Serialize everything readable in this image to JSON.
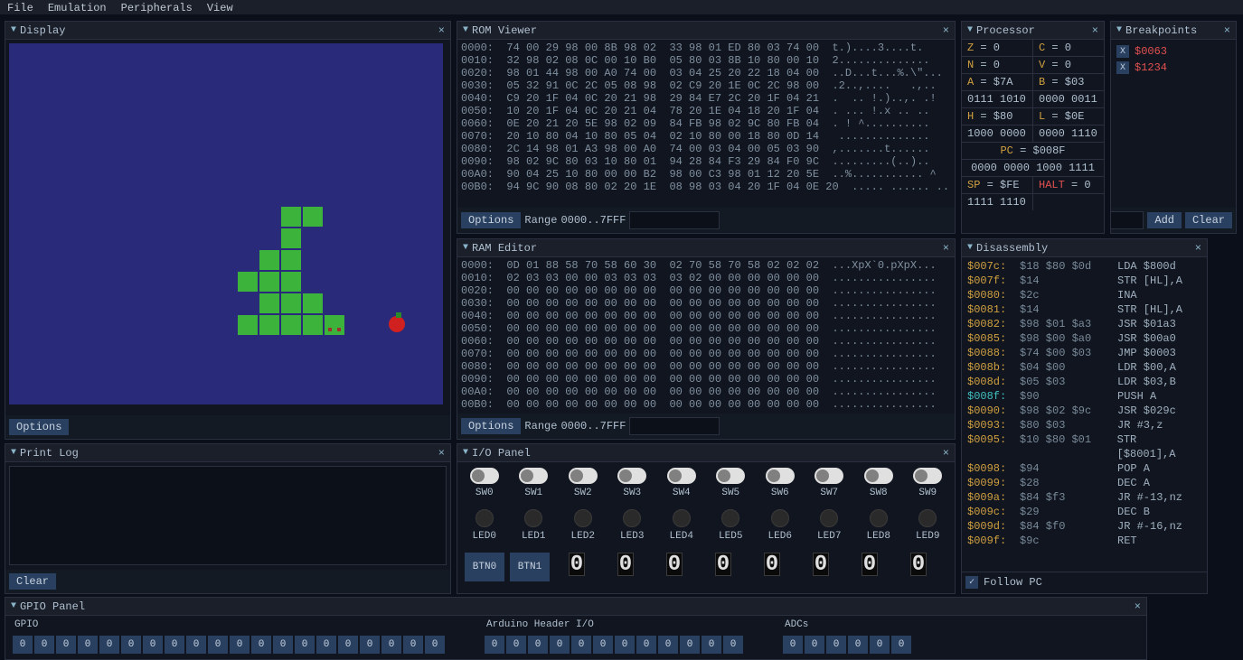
{
  "menu": {
    "file": "File",
    "emulation": "Emulation",
    "peripherals": "Peripherals",
    "view": "View"
  },
  "panels": {
    "display": {
      "title": "Display",
      "options": "Options"
    },
    "rom": {
      "title": "ROM Viewer",
      "options": "Options",
      "range_label": "Range",
      "range": "0000..7FFF"
    },
    "ram": {
      "title": "RAM Editor",
      "options": "Options",
      "range_label": "Range",
      "range": "0000..7FFF"
    },
    "processor": {
      "title": "Processor"
    },
    "breakpoints": {
      "title": "Breakpoints",
      "add": "Add",
      "clear": "Clear"
    },
    "disassembly": {
      "title": "Disassembly",
      "follow": "Follow PC"
    },
    "printlog": {
      "title": "Print Log",
      "clear": "Clear"
    },
    "io": {
      "title": "I/O Panel"
    },
    "gpio": {
      "title": "GPIO Panel",
      "gpio_label": "GPIO",
      "arduino_label": "Arduino Header I/O",
      "adc_label": "ADCs"
    }
  },
  "rom_lines": [
    "0000:  74 00 29 98 00 8B 98 02  33 98 01 ED 80 03 74 00  t.)....3....t.",
    "0010:  32 98 02 08 0C 00 10 B0  05 80 03 8B 10 80 00 10  2..............",
    "0020:  98 01 44 98 00 A0 74 00  03 04 25 20 22 18 04 00  ..D...t...%.\\\"...",
    "0030:  05 32 91 0C 2C 05 08 98  02 C9 20 1E 0C 2C 98 00  .2..,....   .,..",
    "0040:  C9 20 1F 04 0C 20 21 98  29 84 E7 2C 20 1F 04 21  .  .. !.)..,. .!",
    "0050:  10 20 1F 04 0C 20 21 04  78 20 1E 04 18 20 1F 04  . ... !.x .. ..",
    "0060:  0E 20 21 20 5E 98 02 09  84 FB 98 02 9C 80 FB 04  . ! ^..........",
    "0070:  20 10 80 04 10 80 05 04  02 10 80 00 18 80 0D 14   ..............",
    "0080:  2C 14 98 01 A3 98 00 A0  74 00 03 04 00 05 03 90  ,.......t......",
    "0090:  98 02 9C 80 03 10 80 01  94 28 84 F3 29 84 F0 9C  .........(..)..",
    "00A0:  90 04 25 10 80 00 00 B2  98 00 C3 98 01 12 20 5E  ..%........... ^",
    "00B0:  94 9C 90 08 80 02 20 1E  08 98 03 04 20 1F 04 0E 20  ..... ...... .. "
  ],
  "ram_lines": [
    "0000:  0D 01 88 58 70 58 60 30  02 70 58 70 58 02 02 02  ...XpX`0.pXpX...",
    "0010:  02 03 03 00 00 03 03 03  03 02 00 00 00 00 00 00  ................",
    "0020:  00 00 00 00 00 00 00 00  00 00 00 00 00 00 00 00  ................",
    "0030:  00 00 00 00 00 00 00 00  00 00 00 00 00 00 00 00  ................",
    "0040:  00 00 00 00 00 00 00 00  00 00 00 00 00 00 00 00  ................",
    "0050:  00 00 00 00 00 00 00 00  00 00 00 00 00 00 00 00  ................",
    "0060:  00 00 00 00 00 00 00 00  00 00 00 00 00 00 00 00  ................",
    "0070:  00 00 00 00 00 00 00 00  00 00 00 00 00 00 00 00  ................",
    "0080:  00 00 00 00 00 00 00 00  00 00 00 00 00 00 00 00  ................",
    "0090:  00 00 00 00 00 00 00 00  00 00 00 00 00 00 00 00  ................",
    "00A0:  00 00 00 00 00 00 00 00  00 00 00 00 00 00 00 00  ................",
    "00B0:  00 00 00 00 00 00 00 00  00 00 00 00 00 00 00 00  ................"
  ],
  "processor": {
    "Z": "Z = 0",
    "C": "C = 0",
    "N": "N = 0",
    "V": "V = 0",
    "A": "A = $7A",
    "B": "B = $03",
    "A_bits": "0111 1010",
    "B_bits": "0000 0011",
    "H": "H = $80",
    "L": "L = $0E",
    "H_bits": "1000 0000",
    "L_bits": "0000 1110",
    "PC": "PC = $008F",
    "PC_bits": "0000 0000 1000 1111",
    "SP": "SP = $FE",
    "HALT": "HALT = 0",
    "SP_bits": "1111 1110"
  },
  "breakpoints": [
    {
      "addr": "$0063"
    },
    {
      "addr": "$1234"
    }
  ],
  "disassembly": [
    {
      "addr": "$007c:",
      "bytes": "$18 $80 $0d",
      "mnem": "LDA $800d"
    },
    {
      "addr": "$007f:",
      "bytes": "$14",
      "mnem": "STR [HL],A"
    },
    {
      "addr": "$0080:",
      "bytes": "$2c",
      "mnem": "INA"
    },
    {
      "addr": "$0081:",
      "bytes": "$14",
      "mnem": "STR [HL],A"
    },
    {
      "addr": "$0082:",
      "bytes": "$98 $01 $a3",
      "mnem": "JSR $01a3"
    },
    {
      "addr": "$0085:",
      "bytes": "$98 $00 $a0",
      "mnem": "JSR $00a0"
    },
    {
      "addr": "$0088:",
      "bytes": "$74 $00 $03",
      "mnem": "JMP $0003"
    },
    {
      "addr": "$008b:",
      "bytes": "$04 $00",
      "mnem": "LDR $00,A"
    },
    {
      "addr": "$008d:",
      "bytes": "$05 $03",
      "mnem": "LDR $03,B"
    },
    {
      "addr": "$008f:",
      "bytes": "$90",
      "mnem": "PUSH A",
      "active": true
    },
    {
      "addr": "$0090:",
      "bytes": "$98 $02 $9c",
      "mnem": "JSR $029c"
    },
    {
      "addr": "$0093:",
      "bytes": "$80 $03",
      "mnem": "JR #3,z"
    },
    {
      "addr": "$0095:",
      "bytes": "$10 $80 $01",
      "mnem": "STR [$8001],A"
    },
    {
      "addr": "$0098:",
      "bytes": "$94",
      "mnem": "POP A"
    },
    {
      "addr": "$0099:",
      "bytes": "$28",
      "mnem": "DEC A"
    },
    {
      "addr": "$009a:",
      "bytes": "$84 $f3",
      "mnem": "JR #-13,nz"
    },
    {
      "addr": "$009c:",
      "bytes": "$29",
      "mnem": "DEC B"
    },
    {
      "addr": "$009d:",
      "bytes": "$84 $f0",
      "mnem": "JR #-16,nz"
    },
    {
      "addr": "$009f:",
      "bytes": "$9c",
      "mnem": "RET"
    }
  ],
  "io": {
    "switches": [
      "SW0",
      "SW1",
      "SW2",
      "SW3",
      "SW4",
      "SW5",
      "SW6",
      "SW7",
      "SW8",
      "SW9"
    ],
    "leds": [
      "LED0",
      "LED1",
      "LED2",
      "LED3",
      "LED4",
      "LED5",
      "LED6",
      "LED7",
      "LED8",
      "LED9"
    ],
    "btns": [
      "BTN0",
      "BTN1"
    ],
    "seg7_count": 8
  },
  "gpio": {
    "gpio_count": 20,
    "arduino_count": 12,
    "adc_count": 6
  },
  "snake": {
    "segments": [
      [
        300,
        180
      ],
      [
        324,
        180
      ],
      [
        300,
        204
      ],
      [
        300,
        228
      ],
      [
        276,
        228
      ],
      [
        276,
        252
      ],
      [
        300,
        252
      ],
      [
        252,
        252
      ],
      [
        276,
        276
      ],
      [
        300,
        276
      ],
      [
        324,
        276
      ],
      [
        252,
        300
      ],
      [
        276,
        300
      ],
      [
        300,
        300
      ],
      [
        324,
        300
      ],
      [
        348,
        300
      ]
    ],
    "apple": [
      420,
      302
    ]
  }
}
